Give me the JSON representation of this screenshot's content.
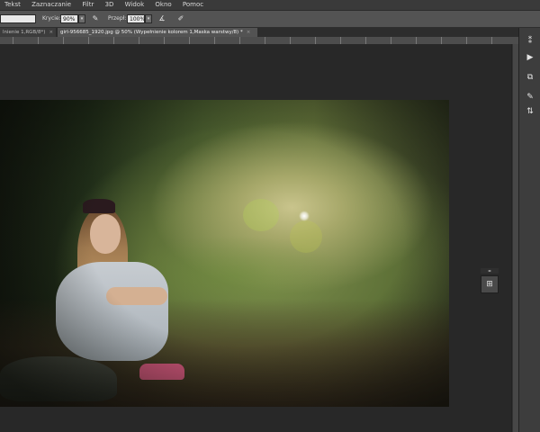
{
  "menu": [
    "Tekst",
    "Zaznaczanie",
    "Filtr",
    "3D",
    "Widok",
    "Okno",
    "Pomoc"
  ],
  "options": {
    "opacity_label": "Krycie:",
    "opacity_value": "90%",
    "flow_label": "Przepł:",
    "flow_value": "100%",
    "brush_icon": "airbrush-icon",
    "pressure_icon": "pressure-icon"
  },
  "tabs": [
    {
      "label": "lnienie 1,RGB/8*)",
      "close": "×",
      "active": false
    },
    {
      "label": "girl-956685_1920.jpg @ 50% (Wypełnienie kolorem 1,Maska warstwy/8) *",
      "close": "×",
      "active": true
    }
  ],
  "dock": {
    "icons": [
      "collapse-icon",
      "play-icon",
      "swatch-icon",
      "brush-presets-icon",
      "adjust-icon"
    ],
    "glyphs": [
      "⁑",
      "▶",
      "⧉",
      "✎",
      "⇅"
    ]
  },
  "navigator": {
    "icon": "navigator-icon",
    "glyph": "⊞",
    "bar": "◂▸"
  },
  "colors": {
    "menubar": "#3a3a3a",
    "options": "#535353",
    "workspace": "#282828"
  }
}
